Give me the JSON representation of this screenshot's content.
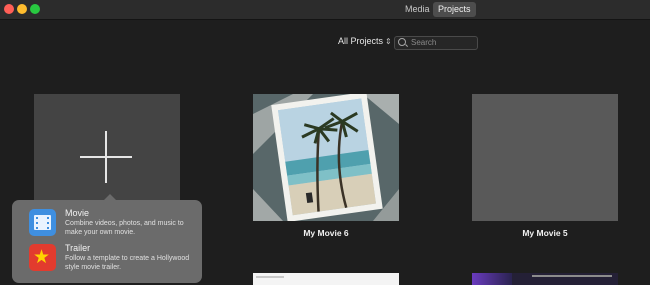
{
  "toolbar": {
    "tabs": [
      {
        "label": "Media"
      },
      {
        "label": "Projects"
      }
    ],
    "filter_label": "All Projects",
    "search_placeholder": "Search"
  },
  "projects": [
    {
      "name": "My Movie 6"
    },
    {
      "name": "My Movie 5"
    }
  ],
  "new_project_menu": {
    "items": [
      {
        "title": "Movie",
        "description": "Combine videos, photos, and music to make your own movie.",
        "icon": "movie-icon"
      },
      {
        "title": "Trailer",
        "description": "Follow a template to create a Hollywood style movie trailer.",
        "icon": "trailer-icon"
      }
    ]
  },
  "colors": {
    "background": "#1e1e1e",
    "titlebar": "#2c2c2c",
    "active_tab": "#4d4d4d",
    "popover": "#6b6b6b",
    "movie_icon": "#3f8fe0",
    "trailer_icon": "#e23b2e"
  }
}
